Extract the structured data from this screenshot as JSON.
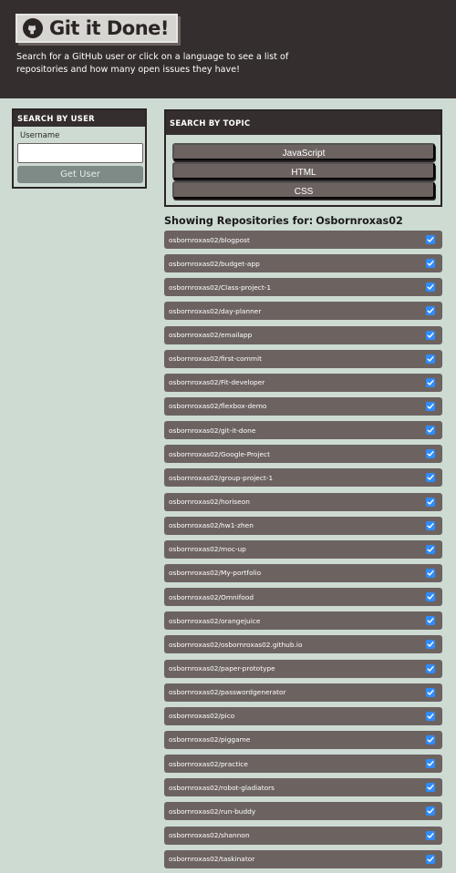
{
  "header": {
    "title": "Git it Done!",
    "subtitle": "Search for a GitHub user or click on a language to see a list of repositories and how many open issues they have!",
    "logo_icon": "github-icon"
  },
  "user_search": {
    "heading": "SEARCH BY USER",
    "username_label": "Username",
    "username_value": "",
    "button_label": "Get User"
  },
  "topic_search": {
    "heading": "SEARCH BY TOPIC",
    "languages": [
      "JavaScript",
      "HTML",
      "CSS"
    ]
  },
  "repos": {
    "heading_prefix": "Showing Repositories for:",
    "username": "Osbornroxas02",
    "status_icon": "checkbox-checked-icon",
    "status_color": "#2d8cff",
    "items": [
      "osbornroxas02/blogpost",
      "osbornroxas02/budget-app",
      "osbornroxas02/Class-project-1",
      "osbornroxas02/day-planner",
      "osbornroxas02/emailapp",
      "osbornroxas02/first-commit",
      "osbornroxas02/Fit-developer",
      "osbornroxas02/flexbox-demo",
      "osbornroxas02/git-it-done",
      "osbornroxas02/Google-Project",
      "osbornroxas02/group-project-1",
      "osbornroxas02/horiseon",
      "osbornroxas02/hw1-zhen",
      "osbornroxas02/moc-up",
      "osbornroxas02/My-portfolio",
      "osbornroxas02/Omnifood",
      "osbornroxas02/orangejuice",
      "osbornroxas02/osbornroxas02.github.io",
      "osbornroxas02/paper-prototype",
      "osbornroxas02/passwordgenerator",
      "osbornroxas02/pico",
      "osbornroxas02/piggame",
      "osbornroxas02/practice",
      "osbornroxas02/robot-gladiators",
      "osbornroxas02/run-buddy",
      "osbornroxas02/shannon",
      "osbornroxas02/taskinator"
    ]
  }
}
